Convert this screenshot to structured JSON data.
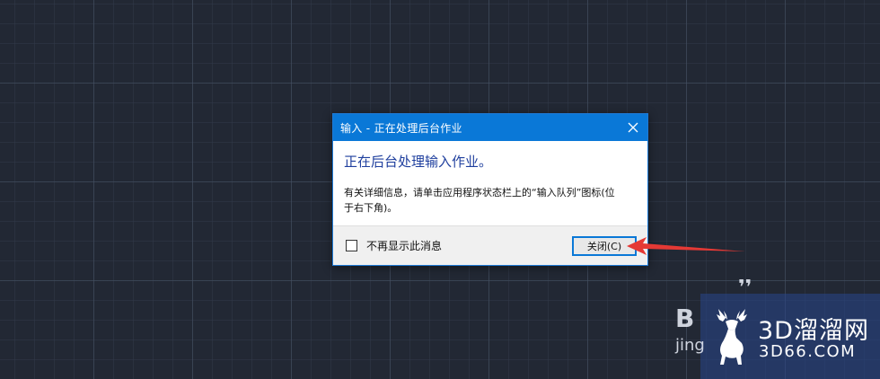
{
  "dialog": {
    "title": "输入 - 正在处理后台作业",
    "main_instruction": "正在后台处理输入作业。",
    "detail_line1": "有关详细信息，请单击应用程序状态栏上的“输入队列”图标(位",
    "detail_line2": "于右下角)。",
    "checkbox_label": "不再显示此消息",
    "checkbox_checked": false,
    "close_button_label": "关闭(C)",
    "close_icon": "close-icon"
  },
  "watermark": {
    "site_name": "3D溜溜网",
    "site_url": "3D66.COM",
    "ghost_letters": "B",
    "ghost_sub": "jing"
  },
  "colors": {
    "titlebar": "#0a78d7",
    "main_instruction": "#1f3f9e",
    "arrow": "#e53935",
    "canvas_background": "#222834"
  }
}
